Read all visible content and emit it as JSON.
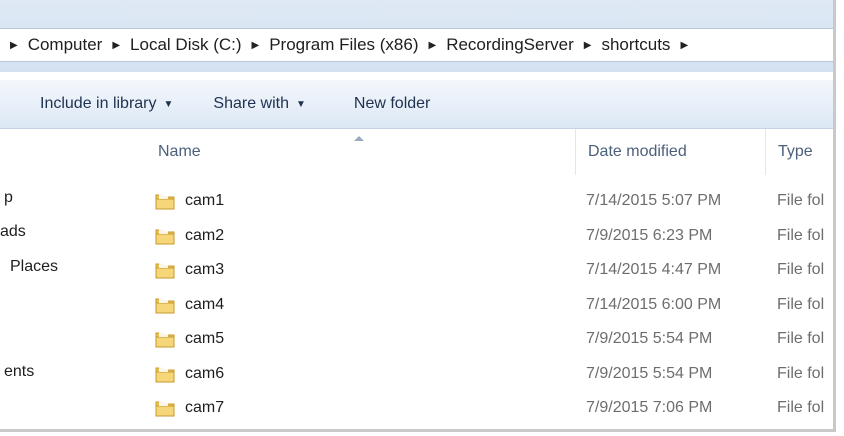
{
  "address_bar": {
    "breadcrumbs": [
      {
        "label": ""
      },
      {
        "label": "Computer"
      },
      {
        "label": "Local Disk (C:)"
      },
      {
        "label": "Program Files (x86)"
      },
      {
        "label": "RecordingServer"
      },
      {
        "label": "shortcuts"
      },
      {
        "label": ""
      }
    ]
  },
  "command_bar": {
    "include_in_library": "Include in library",
    "share_with": "Share with",
    "new_folder": "New folder"
  },
  "nav_pane": {
    "items": [
      "p",
      "ads",
      "Places",
      "ents"
    ]
  },
  "columns": {
    "name": "Name",
    "date_modified": "Date modified",
    "type": "Type"
  },
  "files": [
    {
      "name": "cam1",
      "date": "7/14/2015 5:07 PM",
      "type": "File fol"
    },
    {
      "name": "cam2",
      "date": "7/9/2015 6:23 PM",
      "type": "File fol"
    },
    {
      "name": "cam3",
      "date": "7/14/2015 4:47 PM",
      "type": "File fol"
    },
    {
      "name": "cam4",
      "date": "7/14/2015 6:00 PM",
      "type": "File fol"
    },
    {
      "name": "cam5",
      "date": "7/9/2015 5:54 PM",
      "type": "File fol"
    },
    {
      "name": "cam6",
      "date": "7/9/2015 5:54 PM",
      "type": "File fol"
    },
    {
      "name": "cam7",
      "date": "7/9/2015 7:06 PM",
      "type": "File fol"
    }
  ],
  "icons": {
    "folder": "folder-icon",
    "breadcrumb_separator": "chevron-right-icon",
    "dropdown": "chevron-down-icon"
  }
}
